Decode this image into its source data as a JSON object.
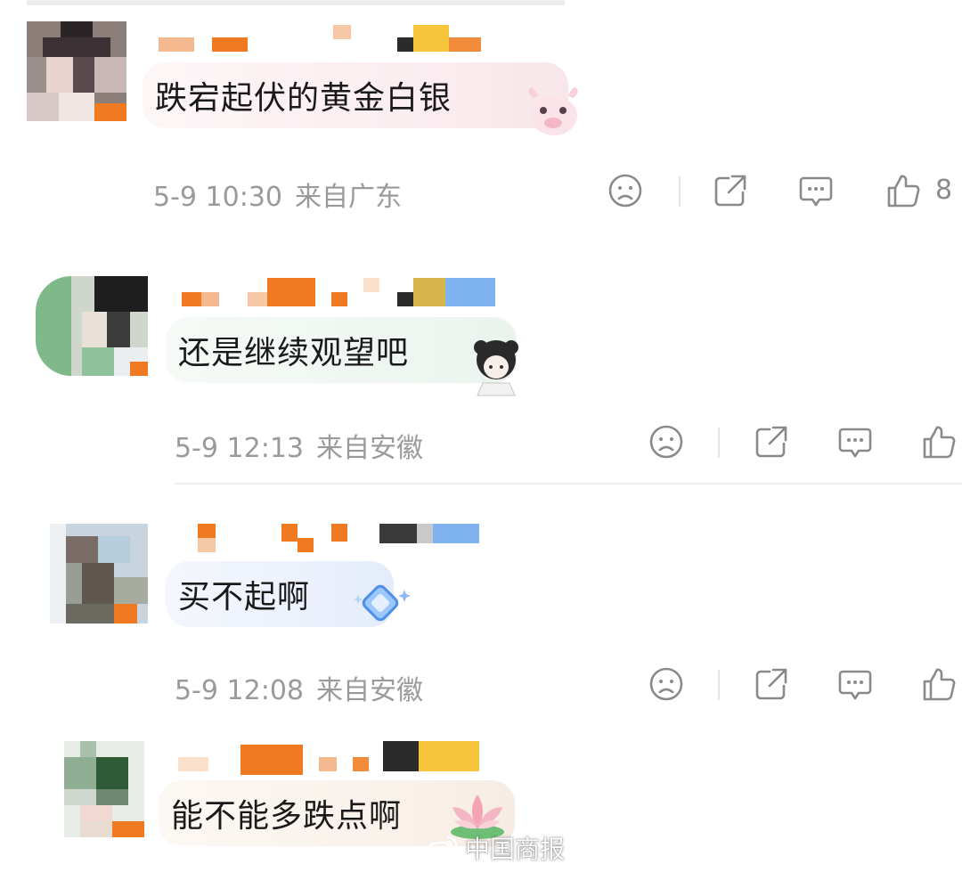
{
  "comments": [
    {
      "text": "跌宕起伏的黄金白银",
      "date": "5-9 10:30",
      "location": "来自广东",
      "likes": "8"
    },
    {
      "text": "还是继续观望吧",
      "date": "5-9 12:13",
      "location": "来自安徽",
      "likes": ""
    },
    {
      "text": "买不起啊",
      "date": "5-9 12:08",
      "location": "来自安徽",
      "likes": ""
    },
    {
      "text": "能不能多跌点啊",
      "date": "",
      "location": "",
      "likes": ""
    }
  ],
  "watermark": {
    "text": "中国商报"
  },
  "icons": [
    "dislike-face-icon",
    "share-icon",
    "reply-comment-icon",
    "thumbs-up-icon"
  ],
  "colors": {
    "meta_text": "#9a9a9a",
    "icon_stroke": "#8a8a8a",
    "mosaic_orange": "#f07a21"
  }
}
